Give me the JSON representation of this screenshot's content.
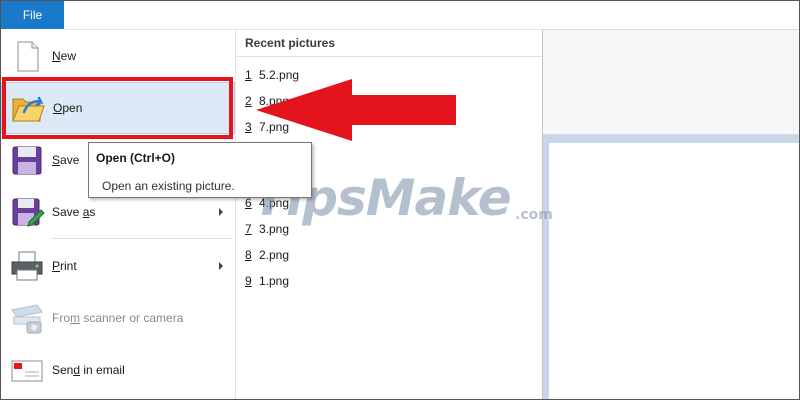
{
  "titlebar": {
    "file_tab_label": "File"
  },
  "menu": {
    "items": [
      {
        "label": "New",
        "icon": "new-document-icon",
        "has_submenu": false,
        "enabled": true
      },
      {
        "label": "Open",
        "icon": "open-folder-icon",
        "has_submenu": false,
        "enabled": true,
        "highlighted": true
      },
      {
        "label": "Save",
        "icon": "save-disk-icon",
        "has_submenu": false,
        "enabled": true
      },
      {
        "label": "Save as",
        "icon": "save-as-icon",
        "has_submenu": true,
        "enabled": true
      },
      {
        "label": "Print",
        "icon": "printer-icon",
        "has_submenu": true,
        "enabled": true
      },
      {
        "label": "From scanner or camera",
        "icon": "scanner-icon",
        "has_submenu": false,
        "enabled": false
      },
      {
        "label": "Send in email",
        "icon": "email-icon",
        "has_submenu": false,
        "enabled": true
      }
    ]
  },
  "recent": {
    "header": "Recent pictures",
    "items": [
      {
        "num": "1",
        "name": "5.2.png"
      },
      {
        "num": "2",
        "name": "8.png"
      },
      {
        "num": "3",
        "name": "7.png"
      },
      {
        "num": "6",
        "name": "4.png"
      },
      {
        "num": "7",
        "name": "3.png"
      },
      {
        "num": "8",
        "name": "2.png"
      },
      {
        "num": "9",
        "name": "1.png"
      }
    ]
  },
  "tooltip": {
    "title": "Open (Ctrl+O)",
    "description": "Open an existing picture."
  },
  "annotation": {
    "arrow_color": "#e3141c",
    "box_color": "#e3141c"
  },
  "watermark": {
    "main": "TipsMake",
    "sub": ".com"
  },
  "colors": {
    "file_tab": "#1979ca",
    "highlight": "#dceaf7"
  }
}
